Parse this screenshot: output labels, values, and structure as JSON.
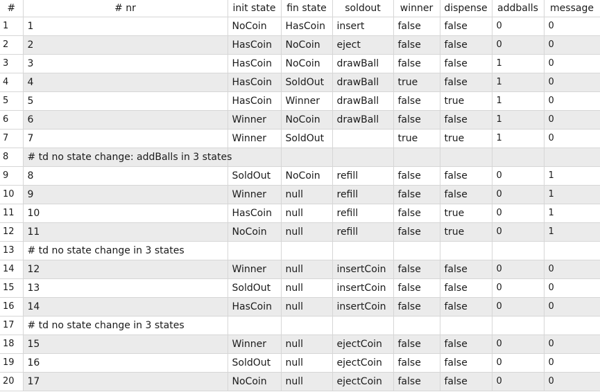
{
  "headers": [
    "#",
    "# nr",
    "init state",
    "fin state",
    "soldout",
    "winner",
    "dispense",
    "addballs",
    "message"
  ],
  "rows": [
    {
      "n": "1",
      "alt": false,
      "cells": [
        "1",
        "NoCoin",
        "HasCoin",
        "insert",
        "false",
        "false",
        "0",
        "0"
      ]
    },
    {
      "n": "2",
      "alt": true,
      "cells": [
        "2",
        "HasCoin",
        "NoCoin",
        "eject",
        "false",
        "false",
        "0",
        "0"
      ]
    },
    {
      "n": "3",
      "alt": false,
      "cells": [
        "3",
        "HasCoin",
        "NoCoin",
        "drawBall",
        "false",
        "false",
        "1",
        "0"
      ]
    },
    {
      "n": "4",
      "alt": true,
      "cells": [
        "4",
        "HasCoin",
        "SoldOut",
        "drawBall",
        "true",
        "false",
        "1",
        "0"
      ]
    },
    {
      "n": "5",
      "alt": false,
      "cells": [
        "5",
        "HasCoin",
        "Winner",
        "drawBall",
        "false",
        "true",
        "1",
        "0"
      ]
    },
    {
      "n": "6",
      "alt": true,
      "cells": [
        "6",
        "Winner",
        "NoCoin",
        "drawBall",
        "false",
        "false",
        "1",
        "0"
      ]
    },
    {
      "n": "7",
      "alt": false,
      "cells": [
        "7",
        "Winner",
        "SoldOut",
        "",
        "true",
        "true",
        "1",
        "0"
      ]
    },
    {
      "n": "8",
      "alt": true,
      "comment": "# td no state change: addBalls in 3 states"
    },
    {
      "n": "9",
      "alt": false,
      "cells": [
        "8",
        "SoldOut",
        "NoCoin",
        "refill",
        "false",
        "false",
        "0",
        "1"
      ]
    },
    {
      "n": "10",
      "alt": true,
      "cells": [
        "9",
        "Winner",
        "null",
        "refill",
        "false",
        "false",
        "0",
        "1"
      ]
    },
    {
      "n": "11",
      "alt": false,
      "cells": [
        "10",
        "HasCoin",
        "null",
        "refill",
        "false",
        "true",
        "0",
        "1"
      ]
    },
    {
      "n": "12",
      "alt": true,
      "cells": [
        "11",
        "NoCoin",
        "null",
        "refill",
        "false",
        "true",
        "0",
        "1"
      ]
    },
    {
      "n": "13",
      "alt": false,
      "comment": "# td no state change in 3 states"
    },
    {
      "n": "14",
      "alt": true,
      "cells": [
        "12",
        "Winner",
        "null",
        "insertCoin",
        "false",
        "false",
        "0",
        "0"
      ]
    },
    {
      "n": "15",
      "alt": false,
      "cells": [
        "13",
        "SoldOut",
        "null",
        "insertCoin",
        "false",
        "false",
        "0",
        "0"
      ]
    },
    {
      "n": "16",
      "alt": true,
      "cells": [
        "14",
        "HasCoin",
        "null",
        "insertCoin",
        "false",
        "false",
        "0",
        "0"
      ]
    },
    {
      "n": "17",
      "alt": false,
      "comment": "# td no state change in 3 states"
    },
    {
      "n": "18",
      "alt": true,
      "cells": [
        "15",
        "Winner",
        "null",
        "ejectCoin",
        "false",
        "false",
        "0",
        "0"
      ]
    },
    {
      "n": "19",
      "alt": false,
      "cells": [
        "16",
        "SoldOut",
        "null",
        "ejectCoin",
        "false",
        "false",
        "0",
        "0"
      ]
    },
    {
      "n": "20",
      "alt": true,
      "cells": [
        "17",
        "NoCoin",
        "null",
        "ejectCoin",
        "false",
        "false",
        "0",
        "0"
      ]
    }
  ]
}
